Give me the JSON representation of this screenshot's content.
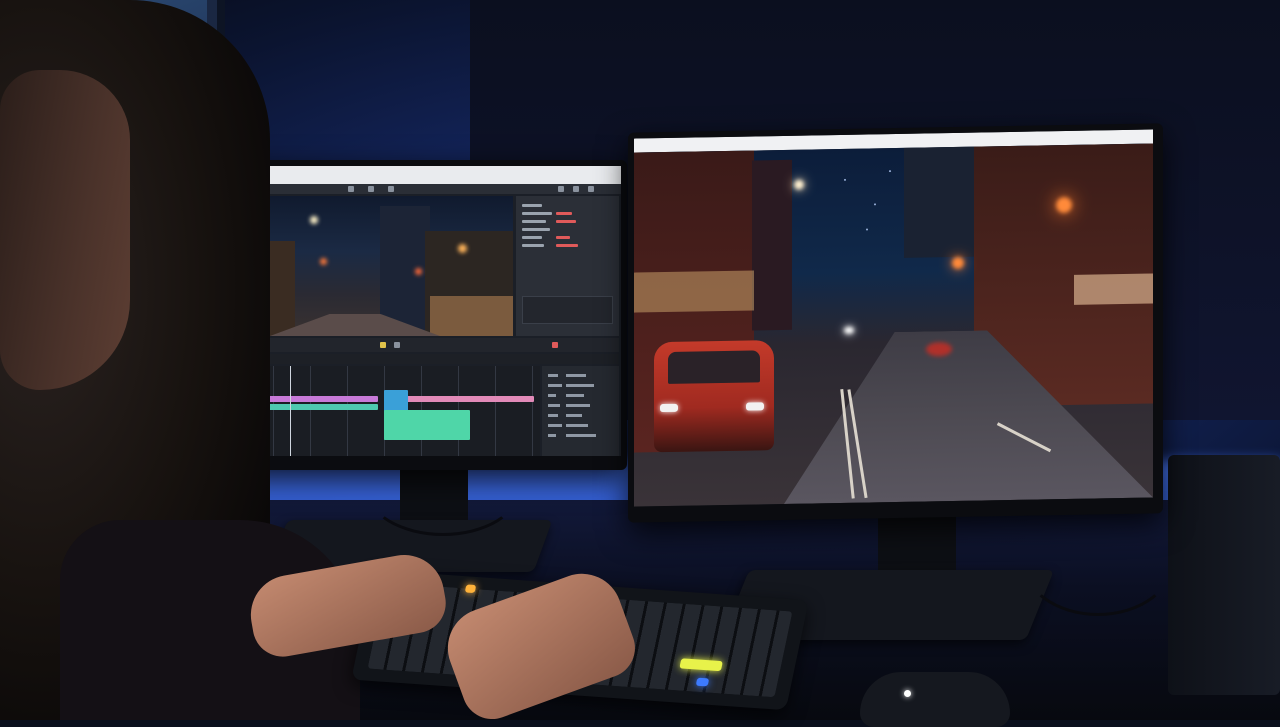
{
  "scene": {
    "description_tags": [
      "video-editing-setup",
      "dual-monitor",
      "night-street-footage"
    ],
    "colors": {
      "ambient_blue": "#3d6ef0",
      "street_light_orange": "#ff7a2a",
      "car_red": "#c43a2a",
      "key_yellow": "#e8f24a",
      "key_blue": "#3d7bff"
    }
  },
  "left_monitor": {
    "app": "video-editor",
    "panels": [
      "viewer",
      "inspector",
      "transport-controls",
      "timeline",
      "scopes"
    ],
    "icons": [
      "play-icon",
      "stop-icon",
      "marker-icon"
    ]
  },
  "right_monitor": {
    "content": "fullscreen-preview"
  }
}
